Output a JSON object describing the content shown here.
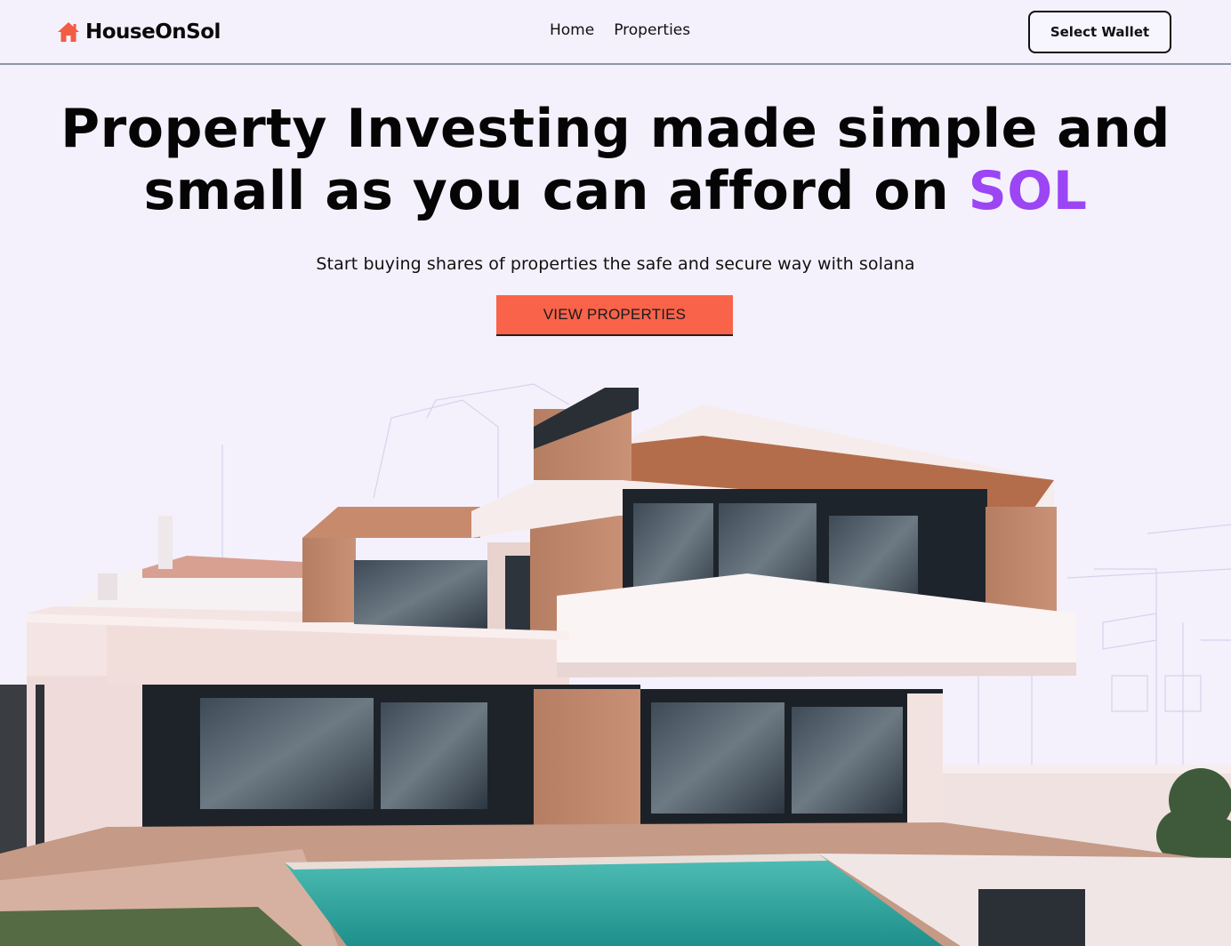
{
  "brand": {
    "name": "HouseOnSol",
    "icon": "house-icon",
    "icon_color": "#f25c45"
  },
  "nav": {
    "links": [
      "Home",
      "Properties"
    ]
  },
  "wallet": {
    "label": "Select Wallet"
  },
  "hero": {
    "title_line1": "Property Investing made simple and",
    "title_line2_prefix": "small as you can afford on ",
    "title_accent": "SOL",
    "subtitle": "Start buying shares of properties the safe and secure way with solana",
    "cta_label": "VIEW PROPERTIES"
  },
  "colors": {
    "background": "#f4f1fc",
    "accent_purple": "#9b45f5",
    "cta_orange": "#f9634a"
  }
}
